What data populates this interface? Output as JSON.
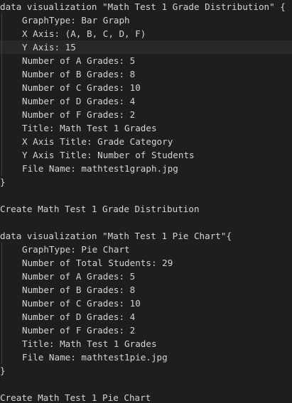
{
  "editor": {
    "lines": [
      "data visualization \"Math Test 1 Grade Distribution\" {",
      "GraphType: Bar Graph",
      "X Axis: (A, B, C, D, F)",
      "Y Axis: 15",
      "Number of A Grades: 5",
      "Number of B Grades: 8",
      "Number of C Grades: 10",
      "Number of D Grades: 4",
      "Number of F Grades: 2",
      "Title: Math Test 1 Grades",
      "X Axis Title: Grade Category",
      "Y Axis Title: Number of Students",
      "File Name: mathtest1graph.jpg",
      "}",
      "",
      "Create Math Test 1 Grade Distribution",
      "",
      "data visualization \"Math Test 1 Pie Chart\"{",
      "GraphType: Pie Chart",
      "Number of Total Students: 29",
      "Number of A Grades: 5",
      "Number of B Grades: 8",
      "Number of C Grades: 10",
      "Number of D Grades: 4",
      "Number of F Grades: 2",
      "Title: Math Test 1 Grades",
      "File Name: mathtest1pie.jpg",
      "}",
      "",
      "Create Math Test 1 Pie Chart"
    ]
  }
}
